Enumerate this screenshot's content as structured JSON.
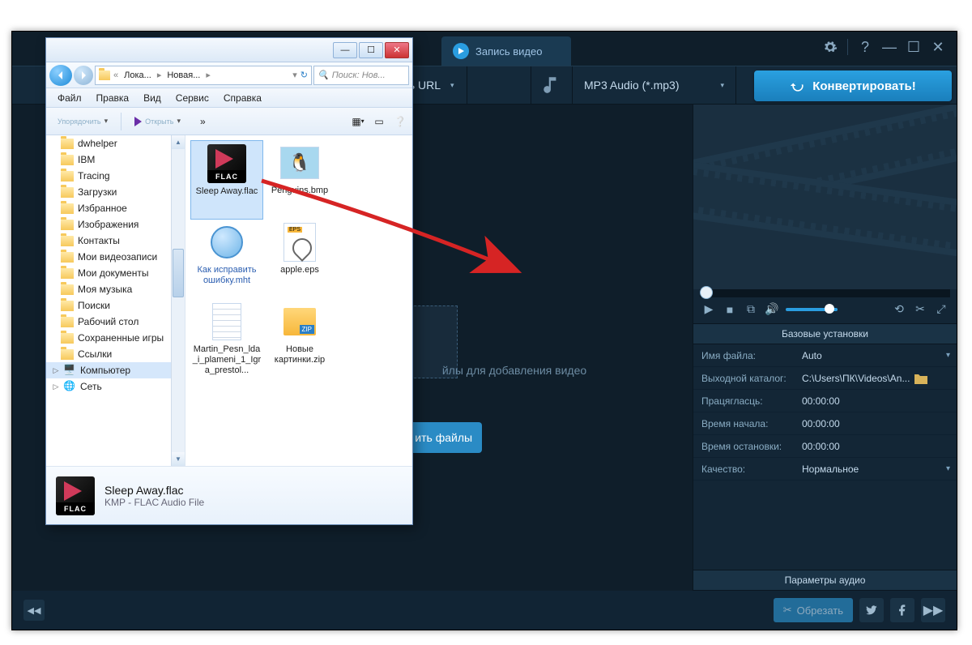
{
  "converter": {
    "tab_label": "Запись видео",
    "url_label": "ть URL",
    "format": "MP3 Audio (*.mp3)",
    "convert_button": "Конвертировать!",
    "drop_message": "йлы для добавления видео",
    "add_button": "ить файлы",
    "trim_button": "Обрезать",
    "settings": {
      "header": "Базовые установки",
      "rows": {
        "filename": {
          "label": "Имя файла:",
          "value": "Auto"
        },
        "outdir": {
          "label": "Выходной каталог:",
          "value": "C:\\Users\\ПК\\Videos\\An..."
        },
        "duration": {
          "label": "Працягласць:",
          "value": "00:00:00"
        },
        "start": {
          "label": "Время начала:",
          "value": "00:00:00"
        },
        "stop": {
          "label": "Время остановки:",
          "value": "00:00:00"
        },
        "quality": {
          "label": "Качество:",
          "value": "Нормальное"
        }
      },
      "audio_params": "Параметры аудио"
    }
  },
  "explorer": {
    "breadcrumb": {
      "part1": "Лока...",
      "part2": "Новая...",
      "refresh": "↻"
    },
    "search_placeholder": "Поиск: Нов...",
    "menu": {
      "file": "Файл",
      "edit": "Правка",
      "view": "Вид",
      "tools": "Сервис",
      "help": "Справка"
    },
    "toolbar": {
      "organize": "Упорядочить",
      "open": "Открыть",
      "more": "»"
    },
    "tree": [
      "dwhelper",
      "IBM",
      "Tracing",
      "Загрузки",
      "Избранное",
      "Изображения",
      "Контакты",
      "Мои видеозаписи",
      "Мои документы",
      "Моя музыка",
      "Поиски",
      "Рабочий стол",
      "Сохраненные игры",
      "Ссылки",
      "Компьютер",
      "Сеть"
    ],
    "files": {
      "flac": "Sleep Away.flac",
      "penguins": "Penguins.bmp",
      "mht": "Как исправить ошибку.mht",
      "eps": "apple.eps",
      "txt": "Martin_Pesn_lda_i_plameni_1_Igra_prestol...",
      "zip": "Новые картинки.zip"
    },
    "details": {
      "name": "Sleep Away.flac",
      "type": "KMP - FLAC Audio File"
    }
  }
}
